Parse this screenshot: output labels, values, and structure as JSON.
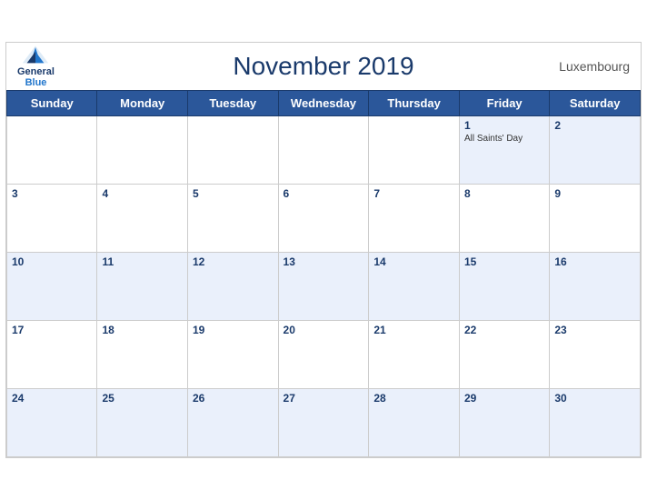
{
  "header": {
    "title": "November 2019",
    "country": "Luxembourg",
    "logo_general": "General",
    "logo_blue": "Blue"
  },
  "weekdays": [
    "Sunday",
    "Monday",
    "Tuesday",
    "Wednesday",
    "Thursday",
    "Friday",
    "Saturday"
  ],
  "weeks": [
    [
      {
        "day": "",
        "empty": true
      },
      {
        "day": "",
        "empty": true
      },
      {
        "day": "",
        "empty": true
      },
      {
        "day": "",
        "empty": true
      },
      {
        "day": "",
        "empty": true
      },
      {
        "day": "1",
        "events": [
          "All Saints' Day"
        ]
      },
      {
        "day": "2",
        "events": []
      }
    ],
    [
      {
        "day": "3",
        "events": []
      },
      {
        "day": "4",
        "events": []
      },
      {
        "day": "5",
        "events": []
      },
      {
        "day": "6",
        "events": []
      },
      {
        "day": "7",
        "events": []
      },
      {
        "day": "8",
        "events": []
      },
      {
        "day": "9",
        "events": []
      }
    ],
    [
      {
        "day": "10",
        "events": []
      },
      {
        "day": "11",
        "events": []
      },
      {
        "day": "12",
        "events": []
      },
      {
        "day": "13",
        "events": []
      },
      {
        "day": "14",
        "events": []
      },
      {
        "day": "15",
        "events": []
      },
      {
        "day": "16",
        "events": []
      }
    ],
    [
      {
        "day": "17",
        "events": []
      },
      {
        "day": "18",
        "events": []
      },
      {
        "day": "19",
        "events": []
      },
      {
        "day": "20",
        "events": []
      },
      {
        "day": "21",
        "events": []
      },
      {
        "day": "22",
        "events": []
      },
      {
        "day": "23",
        "events": []
      }
    ],
    [
      {
        "day": "24",
        "events": []
      },
      {
        "day": "25",
        "events": []
      },
      {
        "day": "26",
        "events": []
      },
      {
        "day": "27",
        "events": []
      },
      {
        "day": "28",
        "events": []
      },
      {
        "day": "29",
        "events": []
      },
      {
        "day": "30",
        "events": []
      }
    ]
  ]
}
